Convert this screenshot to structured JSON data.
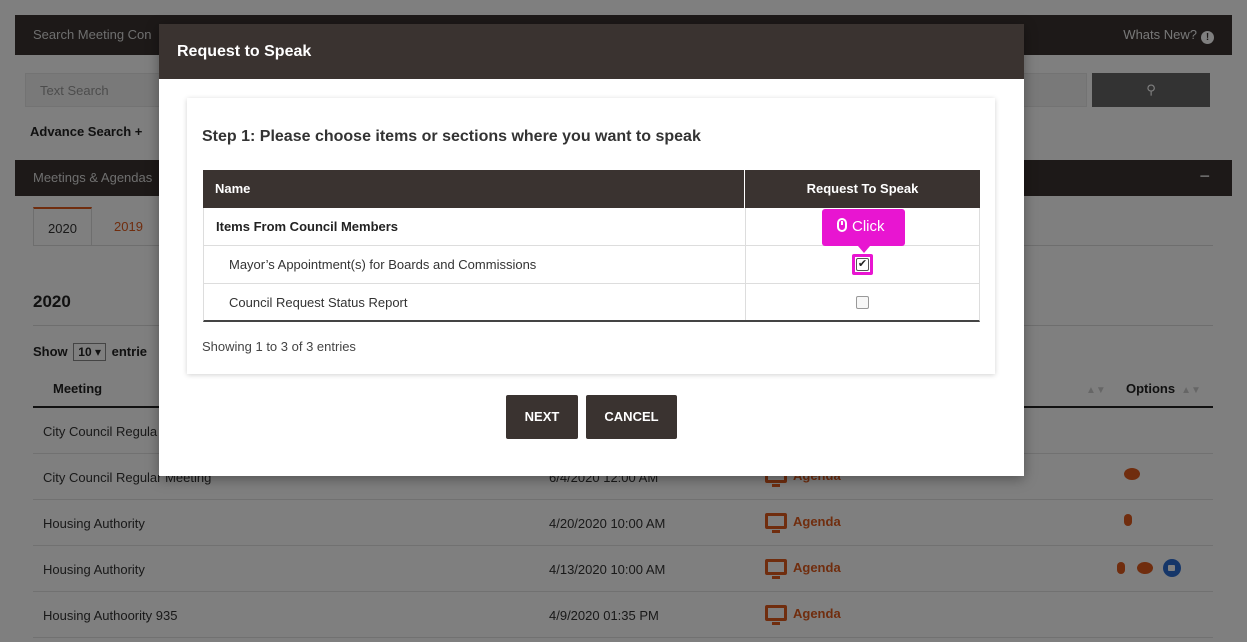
{
  "page": {
    "search_bar_label": "Search Meeting Con",
    "whats_new": "Whats New?",
    "text_search_placeholder": "Text Search",
    "search_btn_icon": "search-icon",
    "advance_search": "Advance Search",
    "meetings_bar": "Meetings & Agendas",
    "collapse_icon": "−",
    "year_tabs": [
      "2020",
      "2019"
    ],
    "year_heading": "2020",
    "show_label": "Show",
    "show_value": "10",
    "entries_label": "entrie",
    "col_meeting": "Meeting",
    "col_options": "Options",
    "rows": [
      {
        "name": "City Council Regula",
        "date": "",
        "agenda": ""
      },
      {
        "name": "City Council Regular Meeting",
        "date": "6/4/2020 12:00 AM",
        "agenda": "Agenda"
      },
      {
        "name": "Housing Authority",
        "date": "4/20/2020 10:00 AM",
        "agenda": "Agenda"
      },
      {
        "name": "Housing Authority",
        "date": "4/13/2020 10:00 AM",
        "agenda": "Agenda"
      },
      {
        "name": "Housing Authoority 935",
        "date": "4/9/2020 01:35 PM",
        "agenda": "Agenda"
      }
    ]
  },
  "modal": {
    "title": "Request to Speak",
    "step": "Step 1: Please choose items or sections where you want to speak",
    "col_name": "Name",
    "col_request": "Request To Speak",
    "items": [
      {
        "name": "Items From Council Members",
        "type": "section",
        "checked": false
      },
      {
        "name": "Mayor’s Appointment(s) for Boards and Commissions",
        "type": "item",
        "checked": true
      },
      {
        "name": "Council Request Status Report",
        "type": "item",
        "checked": false
      }
    ],
    "showing": "Showing 1 to 3 of 3 entries",
    "next": "NEXT",
    "cancel": "CANCEL"
  },
  "tooltip": {
    "label": "Click",
    "icon": "mouse-icon",
    "color": "#e815d1"
  },
  "colors": {
    "header_bg": "#3a3330",
    "accent": "#e05a1c"
  }
}
